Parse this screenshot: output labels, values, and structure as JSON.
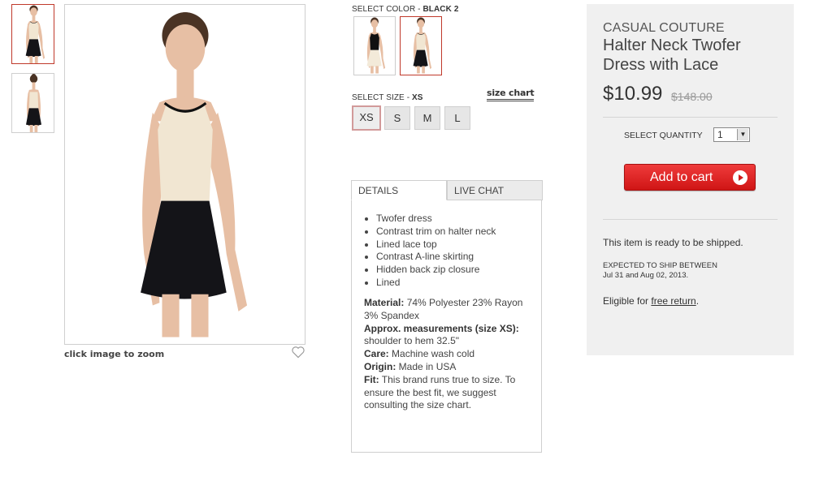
{
  "gallery": {
    "zoom_hint": "click image to zoom"
  },
  "color_select": {
    "label": "SELECT COLOR - ",
    "selected": "BLACK 2"
  },
  "size_select": {
    "label": "SELECT SIZE - ",
    "selected": "XS",
    "sizes": [
      "XS",
      "S",
      "M",
      "L"
    ],
    "chart_link": "size chart"
  },
  "tabs": {
    "details": "DETAILS",
    "live_chat": "LIVE CHAT"
  },
  "details": {
    "bullets": [
      "Twofer dress",
      "Contrast trim on halter neck",
      "Lined lace top",
      "Contrast A-line skirting",
      "Hidden back zip closure",
      "Lined"
    ],
    "material_label": "Material:",
    "material": " 74% Polyester 23% Rayon 3% Spandex",
    "measure_label": "Approx. measurements (size XS):",
    "measure": " shoulder to hem 32.5\"",
    "care_label": "Care:",
    "care": " Machine wash cold",
    "origin_label": "Origin:",
    "origin": " Made in USA",
    "fit_label": "Fit:",
    "fit": " This brand runs true to size. To ensure the best fit, we suggest consulting the size chart."
  },
  "product": {
    "brand": "CASUAL COUTURE",
    "title": "Halter Neck Twofer Dress with Lace",
    "price": "$10.99",
    "original_price": "$148.00"
  },
  "purchase": {
    "qty_label": "SELECT QUANTITY",
    "qty_value": "1",
    "add_to_cart": "Add to cart",
    "ship_status": "This item is ready to be shipped.",
    "expected_label": "EXPECTED TO SHIP BETWEEN",
    "expected_dates": "Jul 31 and Aug 02, 2013.",
    "return_prefix": "Eligible for ",
    "return_link": "free return",
    "return_suffix": "."
  },
  "colors": {
    "accent_red": "#d11b1b",
    "selected_border": "#c0392b",
    "panel_bg": "#f0f0f0"
  },
  "icons": {
    "wishlist": "heart-outline-icon",
    "cart_button": "arrow-right-circle-icon",
    "qty_dropdown": "chevron-down-icon"
  }
}
